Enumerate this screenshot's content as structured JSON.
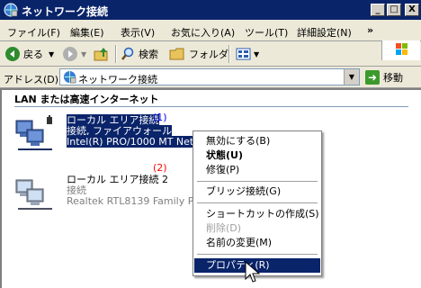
{
  "window": {
    "title": "ネットワーク接続",
    "minimize": "_",
    "maximize": "□",
    "close": "X"
  },
  "menu": [
    "ファイル(F)",
    "編集(E)",
    "表示(V)",
    "お気に入り(A)",
    "ツール(T)",
    "詳細設定(N)"
  ],
  "menu_more": "»",
  "toolbar": {
    "back": "戻る",
    "search": "検索",
    "folders": "フォルダ"
  },
  "address": {
    "label": "アドレス(D)",
    "value": "ネットワーク接続",
    "go": "移動"
  },
  "content": {
    "group_header": "LAN または高速インターネット",
    "connections": [
      {
        "line1": "ローカル エリア接続",
        "line2": "接続, ファイアウォール",
        "line3": "Intel(R) PRO/1000 MT Net",
        "annotation": "(1)"
      },
      {
        "line1": "ローカル エリア接続 2",
        "line2": "接続",
        "line3": "Realtek RTL8139 Family P",
        "annotation": "(2)"
      }
    ]
  },
  "context_menu": {
    "items": [
      {
        "label": "無効にする(B)"
      },
      {
        "label": "状態(U)"
      },
      {
        "label": "修復(P)"
      },
      {
        "label": "ブリッジ接続(G)"
      },
      {
        "label": "ショートカットの作成(S)"
      },
      {
        "label": "削除(D)"
      },
      {
        "label": "名前の変更(M)"
      },
      {
        "label": "プロパティ(R)"
      }
    ]
  },
  "colors": {
    "selection": "#0a246a",
    "annotation_1": "#0000ff",
    "annotation_2": "#ff0000"
  }
}
